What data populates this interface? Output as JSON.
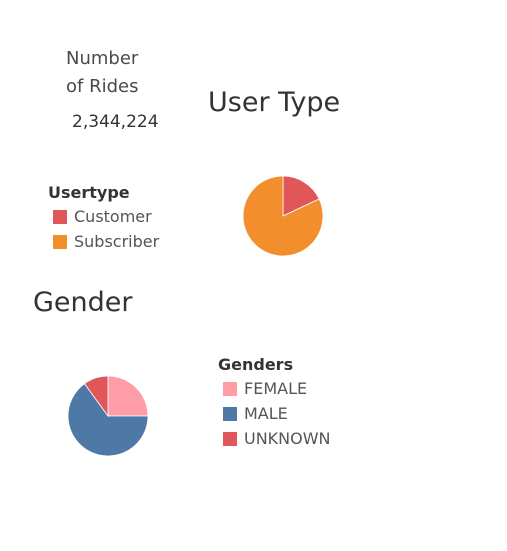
{
  "kpi": {
    "label_line1": "Number",
    "label_line2": "of Rides",
    "value": "2,344,224"
  },
  "chart_data": [
    {
      "type": "pie",
      "title": "User Type",
      "legend_title": "Usertype",
      "legend_placement": "left",
      "categories": [
        "Customer",
        "Subscriber"
      ],
      "values": [
        0.18,
        0.82
      ],
      "colors": [
        "#E15759",
        "#F28E2B"
      ],
      "start_angle_deg": 0
    },
    {
      "type": "pie",
      "title": "Gender",
      "legend_title": "Genders",
      "legend_placement": "right",
      "categories": [
        "FEMALE",
        "MALE",
        "UNKNOWN"
      ],
      "values": [
        0.25,
        0.65,
        0.1
      ],
      "colors": [
        "#FF9DA7",
        "#4E79A7",
        "#E15759"
      ],
      "start_angle_deg": 0
    }
  ]
}
